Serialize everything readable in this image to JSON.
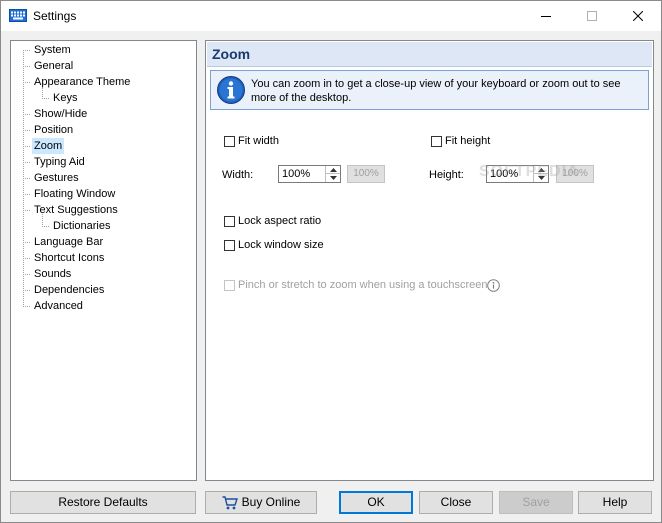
{
  "window": {
    "title": "Settings"
  },
  "tree": {
    "items": [
      {
        "label": "System",
        "level": 0
      },
      {
        "label": "General",
        "level": 0
      },
      {
        "label": "Appearance Theme",
        "level": 0
      },
      {
        "label": "Keys",
        "level": 1
      },
      {
        "label": "Show/Hide",
        "level": 0
      },
      {
        "label": "Position",
        "level": 0
      },
      {
        "label": "Zoom",
        "level": 0,
        "selected": true
      },
      {
        "label": "Typing Aid",
        "level": 0
      },
      {
        "label": "Gestures",
        "level": 0
      },
      {
        "label": "Floating Window",
        "level": 0
      },
      {
        "label": "Text Suggestions",
        "level": 0
      },
      {
        "label": "Dictionaries",
        "level": 1
      },
      {
        "label": "Language Bar",
        "level": 0
      },
      {
        "label": "Shortcut Icons",
        "level": 0
      },
      {
        "label": "Sounds",
        "level": 0
      },
      {
        "label": "Dependencies",
        "level": 0
      },
      {
        "label": "Advanced",
        "level": 0
      }
    ]
  },
  "panel": {
    "title": "Zoom",
    "info": "You can zoom in to get a close-up view of your keyboard or zoom out to see more of the desktop.",
    "fit_width": "Fit width",
    "fit_height": "Fit height",
    "width_label": "Width:",
    "width_value": "100%",
    "width_reset": "100%",
    "height_label": "Height:",
    "height_value": "100%",
    "height_reset": "100%",
    "lock_aspect": "Lock aspect ratio",
    "lock_size": "Lock window size",
    "pinch": "Pinch or stretch to zoom when using a touchscreen"
  },
  "watermark": "SOFTPEDIA",
  "buttons": {
    "restore": "Restore Defaults",
    "buy": "Buy Online",
    "ok": "OK",
    "close": "Close",
    "save": "Save",
    "help": "Help"
  },
  "colors": {
    "selection": "#cce8ff",
    "header_bg": "#dde7f5",
    "header_text": "#1a3a6e",
    "accent": "#0078d7"
  }
}
